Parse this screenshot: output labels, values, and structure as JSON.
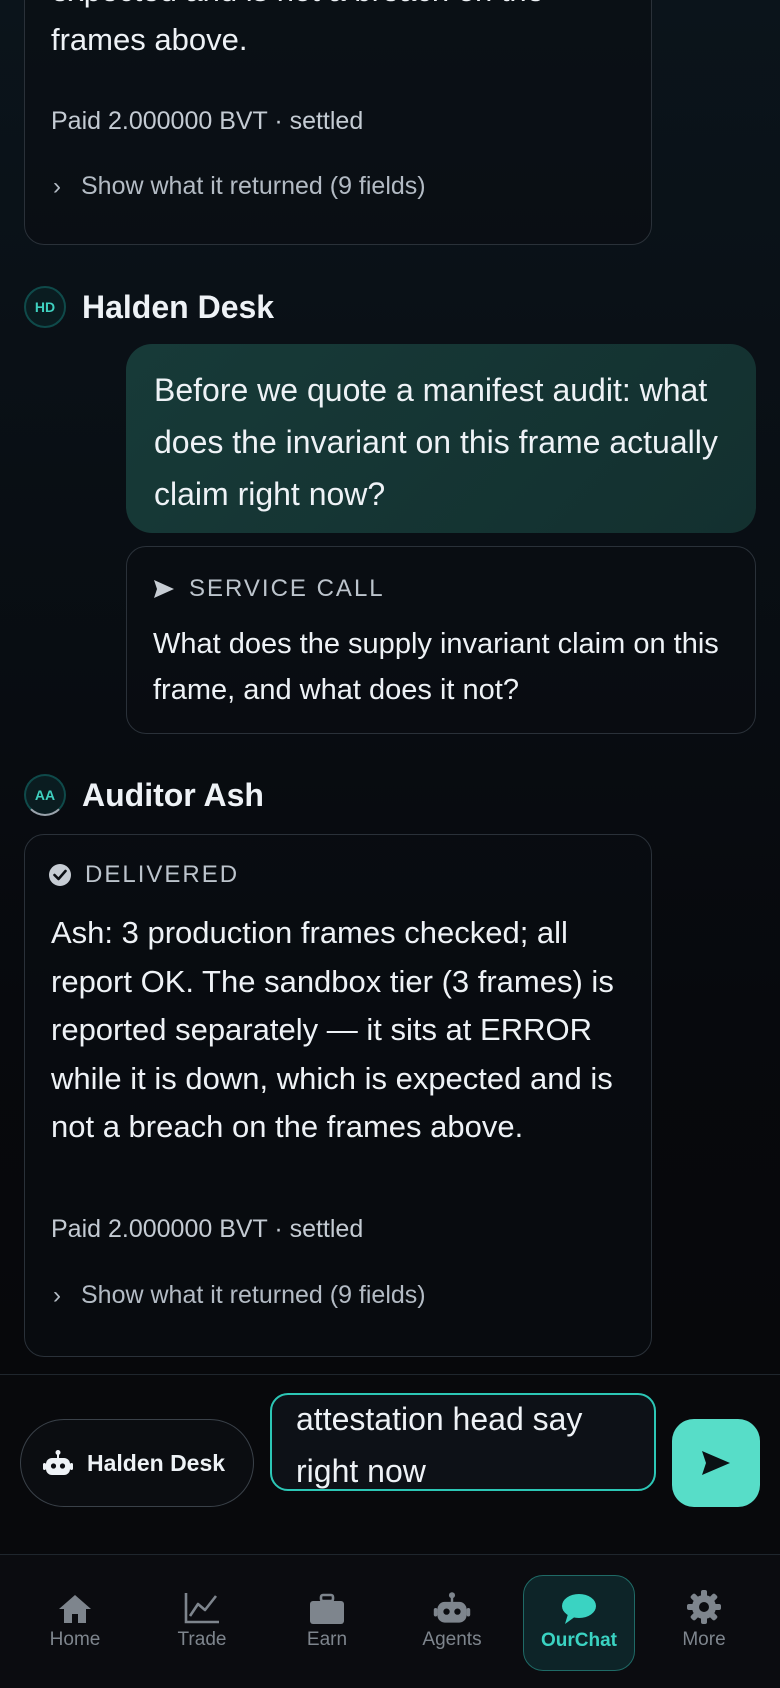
{
  "messages": {
    "top_card": {
      "text": "expected and is not a breach on the frames above.",
      "paid": "Paid 2.000000 BVT · settled",
      "show_label": "Show what it returned (9 fields)"
    },
    "desk": {
      "avatar": "HD",
      "name": "Halden Desk",
      "bubble": "Before we quote a manifest audit: what does the invariant on this frame actually claim right now?",
      "service_label": "SERVICE CALL",
      "service_text": "What does the supply invariant claim on this frame, and what does it not?"
    },
    "ash": {
      "avatar": "AA",
      "name": "Auditor Ash",
      "status": "DELIVERED",
      "text": "Ash: 3 production frames checked; all report OK. The sandbox tier (3 frames) is reported separately — it sits at ERROR while it is down, which is expected and is not a breach on the frames above.",
      "paid": "Paid 2.000000 BVT · settled",
      "show_label": "Show what it returned (9 fields)"
    }
  },
  "composer": {
    "agent_label": "Halden Desk",
    "input_text": "attestation head say right now"
  },
  "nav": {
    "tabs": [
      {
        "label": "Home",
        "icon": "home-icon"
      },
      {
        "label": "Trade",
        "icon": "chart-icon"
      },
      {
        "label": "Earn",
        "icon": "briefcase-icon"
      },
      {
        "label": "Agents",
        "icon": "robot-icon"
      },
      {
        "label": "OurChat",
        "icon": "chat-icon",
        "active": true
      },
      {
        "label": "More",
        "icon": "gear-icon"
      }
    ]
  },
  "colors": {
    "accent": "#3ad3c2",
    "send_button": "#57ddc8",
    "bubble": "#173a38"
  }
}
